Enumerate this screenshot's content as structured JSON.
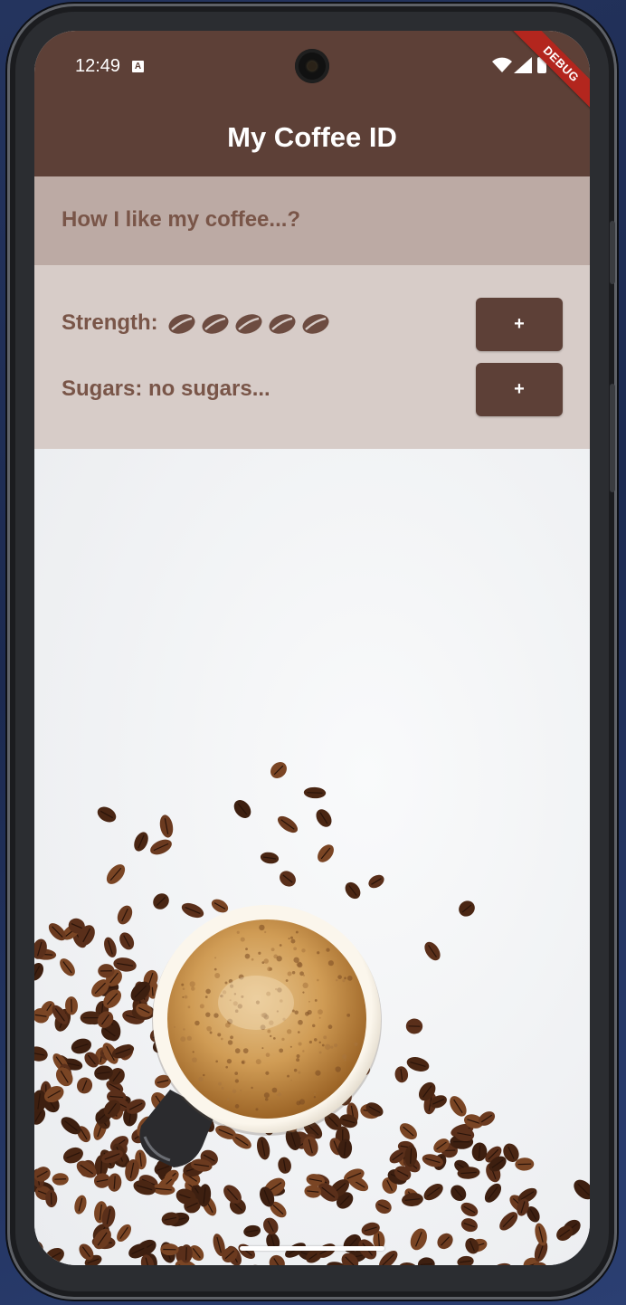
{
  "status_bar": {
    "time": "12:49",
    "notification_icon": "A",
    "icons": [
      "wifi-icon",
      "signal-icon",
      "battery-icon"
    ]
  },
  "debug_banner": "DEBUG",
  "app_bar": {
    "title": "My Coffee ID",
    "color": "#5d4037"
  },
  "question": {
    "text": "How I like my coffee...?",
    "background": "#bcaaa4"
  },
  "preferences": {
    "strength": {
      "label": "Strength:",
      "bean_count": 5,
      "button_label": "+"
    },
    "sugars": {
      "label": "Sugars: no sugars...",
      "button_label": "+"
    },
    "background": "#d7ccc8"
  },
  "image": {
    "description_icon": "coffee-cup-with-beans-image"
  }
}
